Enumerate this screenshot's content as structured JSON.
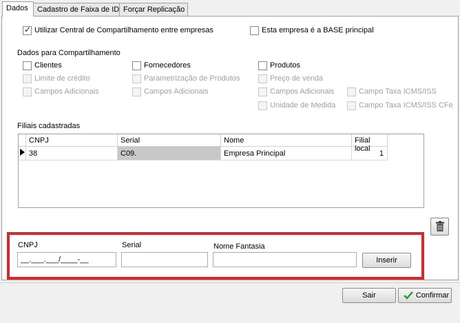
{
  "tabs": [
    {
      "label": "Dados"
    },
    {
      "label": "Cadastro de Faixa de ID"
    },
    {
      "label": "Forçar Replicação"
    }
  ],
  "options": {
    "central": {
      "label": "Utilizar Central de Compartilhamento entre empresas",
      "checked": true
    },
    "base": {
      "label": "Esta empresa é a BASE principal",
      "checked": false
    }
  },
  "sharing": {
    "title": "Dados para Compartilhamento",
    "clientes": {
      "label": "Clientes",
      "limite": "Limite de crédito",
      "campos": "Campos Adicionais"
    },
    "fornecedores": {
      "label": "Fornecedores",
      "param": "Parametrização de Produtos",
      "campos": "Campos Adicionais"
    },
    "produtos": {
      "label": "Produtos",
      "preco": "Preço de venda",
      "campos": "Campos Adicionais",
      "unidade": "Unidade de Medida",
      "icms": "Campo Taxa ICMS/ISS",
      "icms_cfe": "Campo Taxa ICMS/ISS CFe"
    }
  },
  "filiais": {
    "title": "Filiais cadastradas",
    "headers": {
      "cnpj": "CNPJ",
      "serial": "Serial",
      "nome": "Nome",
      "filial": "Filial local"
    },
    "rows": [
      {
        "cnpj": "38",
        "serial": "C09.",
        "nome": "Empresa Principal",
        "filial": "1"
      }
    ]
  },
  "form": {
    "cnpj_label": "CNPJ",
    "cnpj_value": "__.___.___/____-__",
    "serial_label": "Serial",
    "serial_value": "",
    "nome_label": "Nome Fantasia",
    "nome_value": "",
    "inserir": "Inserir"
  },
  "footer": {
    "sair": "Sair",
    "confirmar": "Confirmar"
  },
  "colors": {
    "highlight": "#d8262c",
    "confirm_check": "#2e9e2e"
  },
  "icons": {
    "delete": "trash-icon",
    "confirm": "check-icon",
    "row_pointer": "row-pointer-icon"
  }
}
